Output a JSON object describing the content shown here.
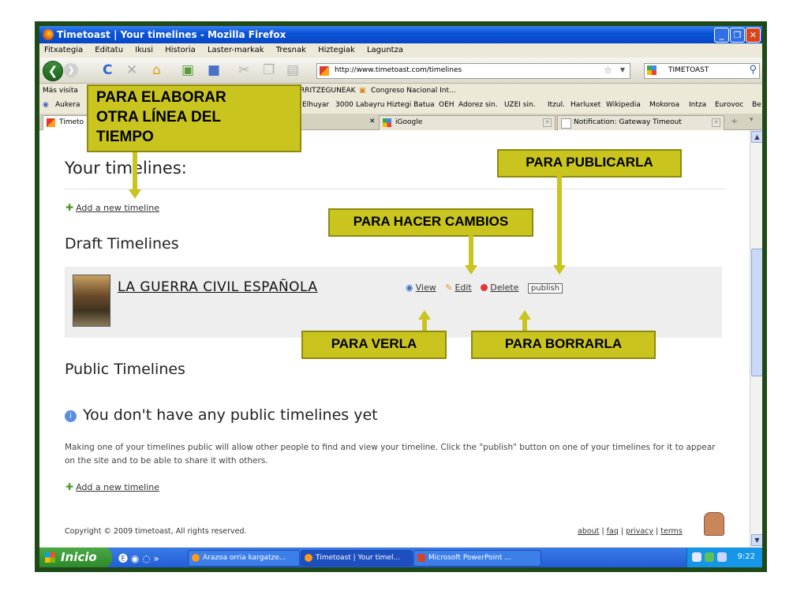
{
  "window": {
    "title": "Timetoast | Your timelines - Mozilla Firefox",
    "min": "_",
    "max": "❐",
    "close": "✕"
  },
  "menu": [
    "Fitxategia",
    "Editatu",
    "Ikusi",
    "Historia",
    "Laster-markak",
    "Tresnak",
    "Hiztegiak",
    "Laguntza"
  ],
  "nav": {
    "url": "http://www.timetoast.com/timelines",
    "search_engine_label": "TIMETOAST"
  },
  "bookmarks_row1": {
    "first": "Más visita",
    "item2": "RRITZEGUNEAK",
    "item3": "Congreso Nacional Int..."
  },
  "bookmarks_row2": [
    "Aukera",
    "Elhuyar",
    "3000",
    "Labayru",
    "Hiztegi Batua",
    "OEH",
    "Adorez sin.",
    "UZEI sin.",
    "Itzul.",
    "Harluxet",
    "Wikipedia",
    "Mokoroa",
    "Intza",
    "Eurovoc",
    "Be"
  ],
  "tabs": [
    {
      "label": "Timeto",
      "active": true
    },
    {
      "label": "iGoogle",
      "active": false
    },
    {
      "label": "Notification: Gateway Timeout",
      "active": false
    }
  ],
  "page": {
    "heading": "Your timelines:",
    "add_new": "Add a new timeline",
    "draft_heading": "Draft Timelines",
    "draft": {
      "title": "LA GUERRA CIVIL ESPAÑOLA",
      "view": "View",
      "edit": "Edit",
      "delete": "Delete",
      "publish": "publish"
    },
    "public_heading": "Public Timelines",
    "no_public": "You don't have any public timelines yet",
    "paragraph": "Making one of your timelines public will allow other people to find and view your timeline. Click the \"publish\" button on one of your timelines for it to appear on the site and to be able to share it with others.",
    "add_new_2": "Add a new timeline",
    "copyright": "Copyright © 2009 timetoast, All rights reserved.",
    "footer_links": [
      "about",
      "faq",
      "privacy",
      "terms"
    ]
  },
  "taskbar": {
    "start": "Inicio",
    "buttons": [
      "Arazoa orria kargatze...",
      "Timetoast | Your timel...",
      "Microsoft PowerPoint ..."
    ],
    "clock": "9:22"
  },
  "annotations": {
    "create": [
      "PARA ELABORAR",
      "OTRA LÍNEA DEL",
      "TIEMPO"
    ],
    "publish": "PARA PUBLICARLA",
    "edit": "PARA HACER CAMBIOS",
    "view": "PARA VERLA",
    "delete": "PARA BORRARLA"
  },
  "colors": {
    "annotation": "#c9c41e",
    "frame": "#1f4a18"
  }
}
